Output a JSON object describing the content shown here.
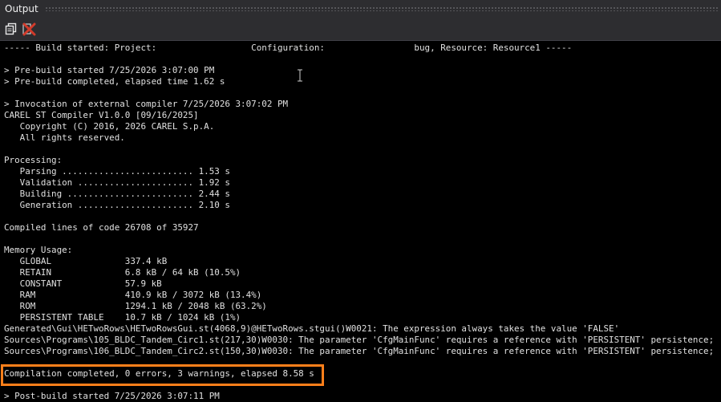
{
  "panel": {
    "title": "Output"
  },
  "toolbar": {
    "buttons": [
      {
        "icon": "copy-icon",
        "label": "Copy"
      },
      {
        "icon": "clear-icon",
        "label": "Clear"
      }
    ]
  },
  "colors": {
    "background": "#000000",
    "text": "#e0e0e0",
    "highlight_border": "#ff7f1a",
    "clear_icon": "#d23a2a"
  },
  "output": {
    "lines": [
      "----- Build started: Project:                  Configuration:               Debug, Resource: Resource1 -----",
      "",
      "> Pre-build started 7/25/2026 3:07:00 PM",
      "> Pre-build completed, elapsed time 1.62 s",
      "",
      "> Invocation of external compiler 7/25/2026 3:07:02 PM",
      "CAREL ST Compiler V1.0.0 [09/16/2025]",
      "   Copyright (C) 2016, 2026 CAREL S.p.A.",
      "   All rights reserved.",
      "",
      "Processing:",
      "   Parsing ......................... 1.53 s",
      "   Validation ...................... 1.92 s",
      "   Building ........................ 2.44 s",
      "   Generation ...................... 2.10 s",
      "",
      "Compiled lines of code 26708 of 35927",
      "",
      "Memory Usage:",
      "   GLOBAL              337.4 kB",
      "   RETAIN              6.8 kB / 64 kB (10.5%)",
      "   CONSTANT            57.9 kB",
      "   RAM                 410.9 kB / 3072 kB (13.4%)",
      "   ROM                 1294.1 kB / 2048 kB (63.2%)",
      "   PERSISTENT TABLE    10.7 kB / 1024 kB (1%)",
      "Generated\\Gui\\HETwoRows\\HETwoRowsGui.st(4068,9)@HETwoRows.stgui()W0021: The expression always takes the value 'FALSE'",
      "Sources\\Programs\\105_BLDC_Tandem_Circ1.st(217,30)W0030: The parameter 'CfgMainFunc' requires a reference with 'PERSISTENT' persistence;",
      "Sources\\Programs\\106_BLDC_Tandem_Circ2.st(150,30)W0030: The parameter 'CfgMainFunc' requires a reference with 'PERSISTENT' persistence;",
      "",
      "Compilation completed, 0 errors, 3 warnings, elapsed 8.58 s",
      "",
      "> Post-build started 7/25/2026 3:07:11 PM"
    ]
  }
}
